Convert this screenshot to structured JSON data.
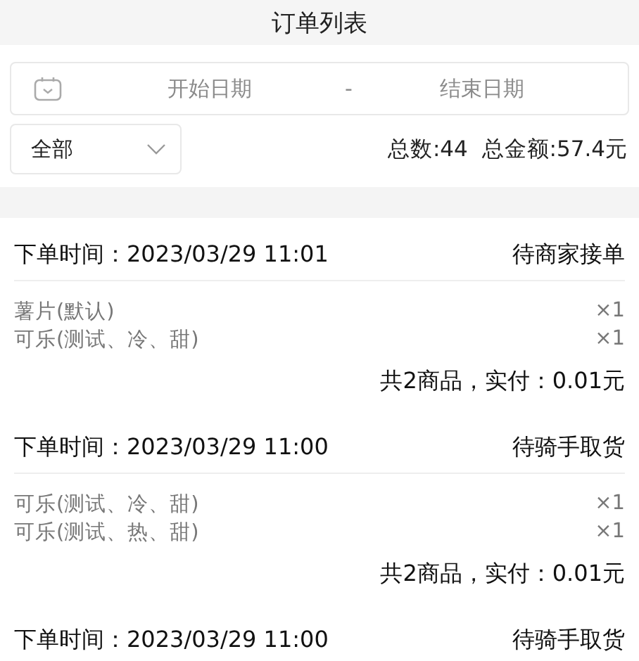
{
  "title": "订单列表",
  "date_range": {
    "start_placeholder": "开始日期",
    "separator": "-",
    "end_placeholder": "结束日期"
  },
  "status_filter": {
    "value": "全部"
  },
  "summary": "总数:44  总金额:57.4元",
  "orders": [
    {
      "time": "下单时间：2023/03/29 11:01",
      "status": "待商家接单",
      "items": [
        {
          "name": "薯片(默认)",
          "qty": "×1"
        },
        {
          "name": "可乐(测试、冷、甜)",
          "qty": "×1"
        }
      ],
      "total": "共2商品，实付：0.01元"
    },
    {
      "time": "下单时间：2023/03/29 11:00",
      "status": "待骑手取货",
      "items": [
        {
          "name": "可乐(测试、冷、甜)",
          "qty": "×1"
        },
        {
          "name": "可乐(测试、热、甜)",
          "qty": "×1"
        }
      ],
      "total": "共2商品，实付：0.01元"
    },
    {
      "time": "下单时间：2023/03/29 11:00",
      "status": "待骑手取货"
    }
  ]
}
